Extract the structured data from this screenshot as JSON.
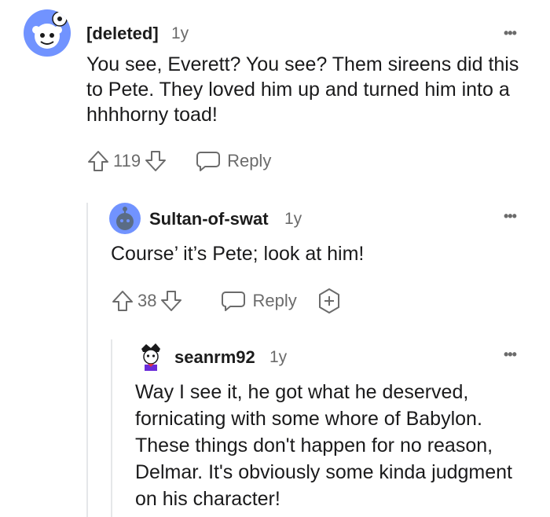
{
  "comments": [
    {
      "username": "[deleted]",
      "age": "1y",
      "text": "You see, Everett? You see? Them sireens did this to Pete. They loved him up and turned him into a hhhhorny toad!",
      "score": "119",
      "reply_label": "Reply"
    },
    {
      "username": "Sultan-of-swat",
      "age": "1y",
      "text": "Course’ it’s Pete; look at him!",
      "score": "38",
      "reply_label": "Reply"
    },
    {
      "username": "seanrm92",
      "age": "1y",
      "text": "Way I see it, he got what he deserved, fornicating with some whore of Babylon. These things don't happen for no reason, Delmar. It's obviously some kinda judgment on his character!"
    }
  ],
  "more_glyph": "•••",
  "colors": {
    "avatar_blue": "#7193ff",
    "text_gray": "#6b6b6b",
    "thread_line": "#e5e7e9"
  }
}
